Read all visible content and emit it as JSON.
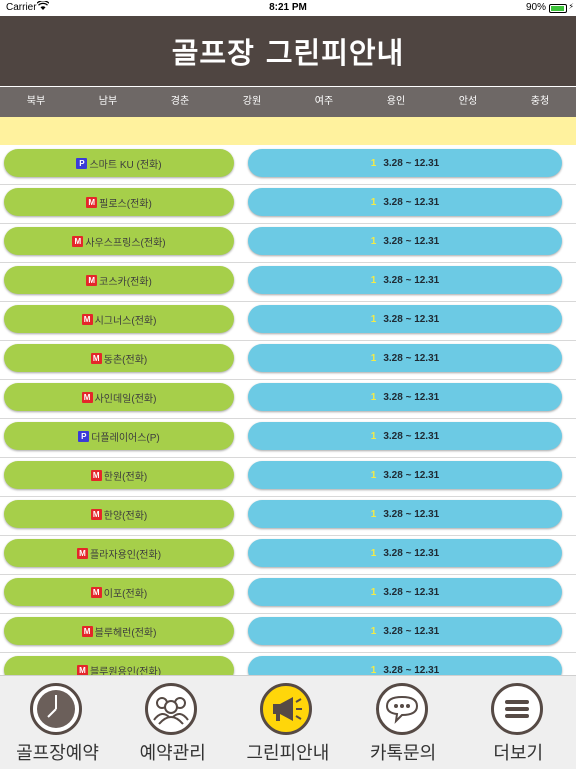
{
  "status": {
    "carrier": "Carrier",
    "time": "8:21 PM",
    "battery": "90%",
    "battery_level": 0.9
  },
  "header": {
    "title": "골프장 그린피안내"
  },
  "regions": [
    "북부",
    "남부",
    "경춘",
    "강원",
    "여주",
    "용인",
    "안성",
    "충청"
  ],
  "courses": [
    {
      "badge": "P",
      "name": "스마트 KU (전화)",
      "period": "3.28 ~ 12.31"
    },
    {
      "badge": "M",
      "name": "필로스(전화)",
      "period": "3.28 ~ 12.31"
    },
    {
      "badge": "M",
      "name": "사우스프링스(전화)",
      "period": "3.28 ~ 12.31"
    },
    {
      "badge": "M",
      "name": "코스카(전화)",
      "period": "3.28 ~ 12.31"
    },
    {
      "badge": "M",
      "name": "시그너스(전화)",
      "period": "3.28 ~ 12.31"
    },
    {
      "badge": "M",
      "name": "동촌(전화)",
      "period": "3.28 ~ 12.31"
    },
    {
      "badge": "M",
      "name": "사인데일(전화)",
      "period": "3.28 ~ 12.31"
    },
    {
      "badge": "P",
      "name": "더플레이어스(P)",
      "period": "3.28 ~ 12.31"
    },
    {
      "badge": "M",
      "name": "한원(전화)",
      "period": "3.28 ~ 12.31"
    },
    {
      "badge": "M",
      "name": "한양(전화)",
      "period": "3.28 ~ 12.31"
    },
    {
      "badge": "M",
      "name": "플라자용인(전화)",
      "period": "3.28 ~ 12.31"
    },
    {
      "badge": "M",
      "name": "이포(전화)",
      "period": "3.28 ~ 12.31"
    },
    {
      "badge": "M",
      "name": "블루헤런(전화)",
      "period": "3.28 ~ 12.31"
    },
    {
      "badge": "M",
      "name": "블루원용인(전화)",
      "period": "3.28 ~ 12.31"
    }
  ],
  "period_flag": "1",
  "nav": [
    {
      "label": "골프장예약",
      "icon": "clock-icon"
    },
    {
      "label": "예약관리",
      "icon": "people-icon"
    },
    {
      "label": "그린피안내",
      "icon": "megaphone-icon",
      "active": true
    },
    {
      "label": "카톡문의",
      "icon": "chat-bubble-icon"
    },
    {
      "label": "더보기",
      "icon": "menu-icon"
    }
  ],
  "colors": {
    "header_bg": "#4f4541",
    "course_button": "#a6cf4a",
    "period_button": "#6ccae4",
    "notice_strip": "#fff29e",
    "active_nav": "#ffd60a"
  }
}
